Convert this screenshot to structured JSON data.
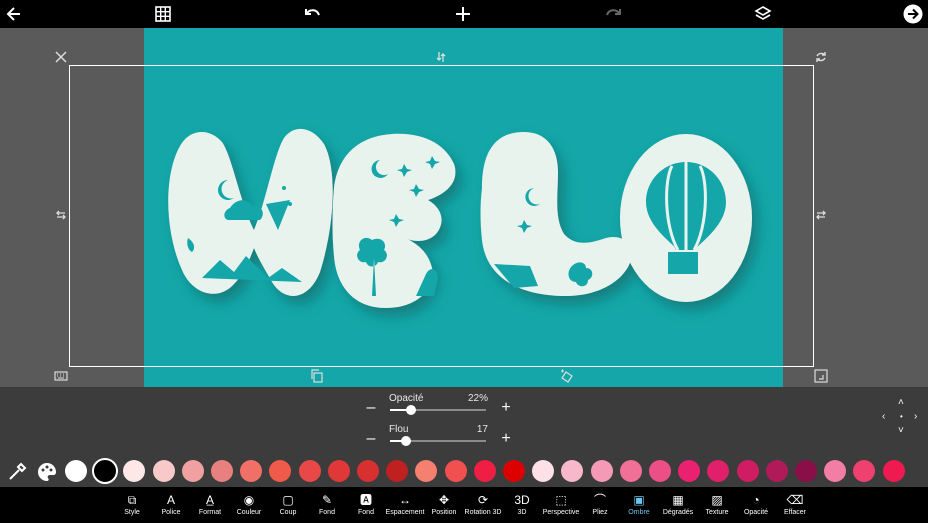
{
  "top_bar": {
    "icons": [
      "back-arrow-icon",
      "grid-icon",
      "undo-icon",
      "add-icon",
      "redo-icon",
      "layers-icon",
      "next-arrow-icon"
    ]
  },
  "canvas": {
    "background_color": "#14a6a8",
    "text_color": "#e8f3ee"
  },
  "sliders": [
    {
      "label": "Opacité",
      "value": "22%",
      "fraction": 0.22
    },
    {
      "label": "Flou",
      "value": "17",
      "fraction": 0.17
    }
  ],
  "swatches": [
    "#ffffff",
    "#000000",
    "#fde7e7",
    "#f9c9c9",
    "#f0a0a0",
    "#e88080",
    "#f07068",
    "#f05a4a",
    "#e84848",
    "#e03838",
    "#d83030",
    "#c02020",
    "#f58070",
    "#f05050",
    "#ee1e44",
    "#dd0000",
    "#fde0e8",
    "#f8b8cc",
    "#f49ab6",
    "#f07098",
    "#ec4e86",
    "#ea2070",
    "#e0206a",
    "#d01c62",
    "#b01a58",
    "#8a0e48",
    "#f27ea6",
    "#f04070",
    "#ee1a50"
  ],
  "selected_swatch_index": 1,
  "toolbar": {
    "active_index": 21,
    "items": [
      {
        "label": "Style",
        "icon": "style-icon"
      },
      {
        "label": "Police",
        "icon": "font-icon"
      },
      {
        "label": "Format",
        "icon": "format-icon"
      },
      {
        "label": "Couleur",
        "icon": "palette-icon"
      },
      {
        "label": "Coup",
        "icon": "stroke-icon"
      },
      {
        "label": "Fond",
        "icon": "brush-icon"
      },
      {
        "label": "Fond",
        "icon": "text-background-icon"
      },
      {
        "label": "Espacement",
        "icon": "spacing-icon"
      },
      {
        "label": "Position",
        "icon": "move-icon"
      },
      {
        "label": "Rotation 3D",
        "icon": "rotation-3d-icon"
      },
      {
        "label": "3D",
        "icon": "3d-icon"
      },
      {
        "label": "Perspective",
        "icon": "perspective-icon"
      },
      {
        "label": "Pliez",
        "icon": "fold-icon"
      },
      {
        "label": "Ombre",
        "icon": "shadow-icon"
      },
      {
        "label": "Dégradés",
        "icon": "gradient-icon"
      },
      {
        "label": "Texture",
        "icon": "texture-icon"
      },
      {
        "label": "Opacité",
        "icon": "opacity-icon"
      },
      {
        "label": "Effacer",
        "icon": "eraser-icon"
      }
    ]
  }
}
